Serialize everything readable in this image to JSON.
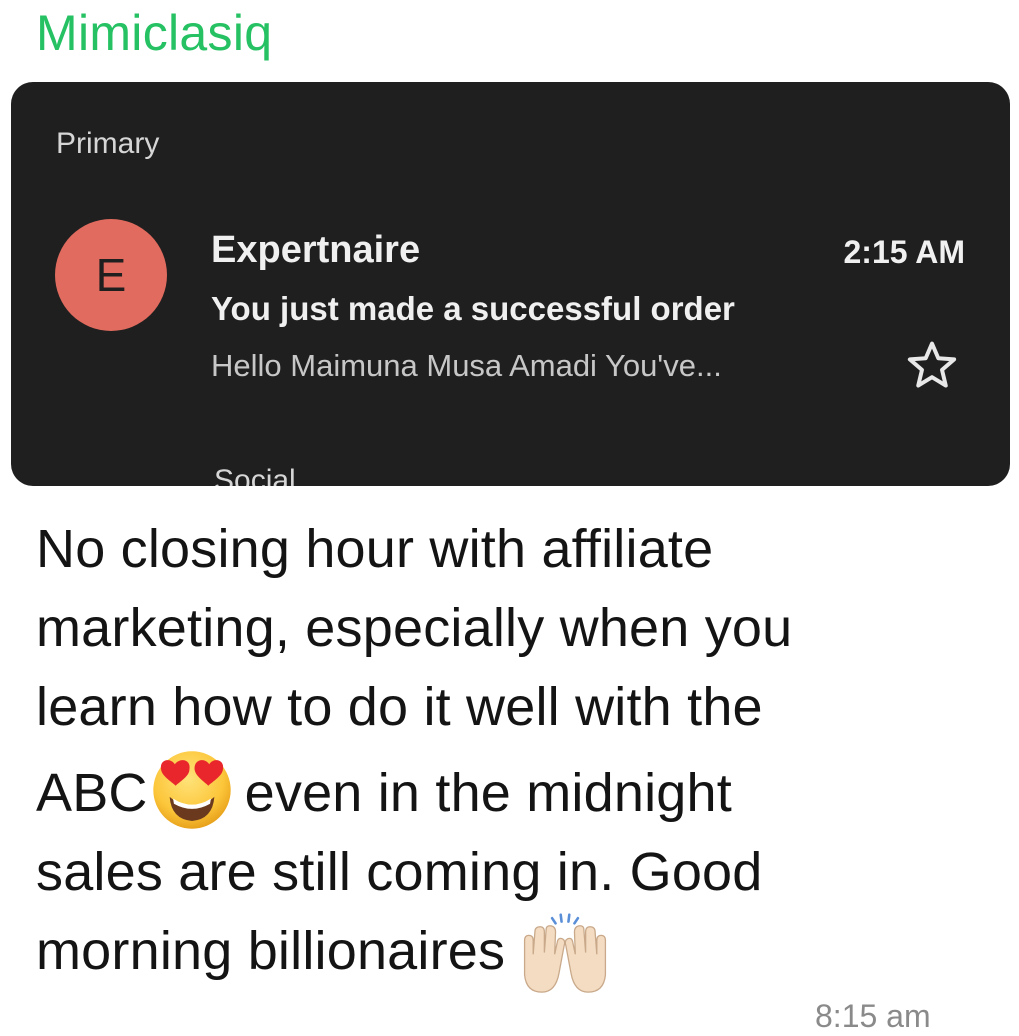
{
  "chat": {
    "sender_name": "Mimiclasiq",
    "sender_color": "#25c163",
    "message_time": "8:15 am"
  },
  "screenshot": {
    "section_label": "Primary",
    "next_section_label": "Social",
    "email": {
      "avatar_letter": "E",
      "avatar_color": "#e06b5e",
      "sender": "Expertnaire",
      "time": "2:15 AM",
      "subject": "You just made a successful order",
      "snippet": "Hello Maimuna Musa Amadi You've..."
    }
  },
  "message": {
    "line1": "No closing hour with affiliate",
    "line2": "marketing, especially when you",
    "line3": "learn how to do it well with the",
    "line4_before": "ABC",
    "line4_after": "even in the midnight",
    "line5": "sales are still coming in. Good",
    "line6": "morning billionaires",
    "emoji_1": "heart-eyes",
    "emoji_2": "raising-hands"
  }
}
